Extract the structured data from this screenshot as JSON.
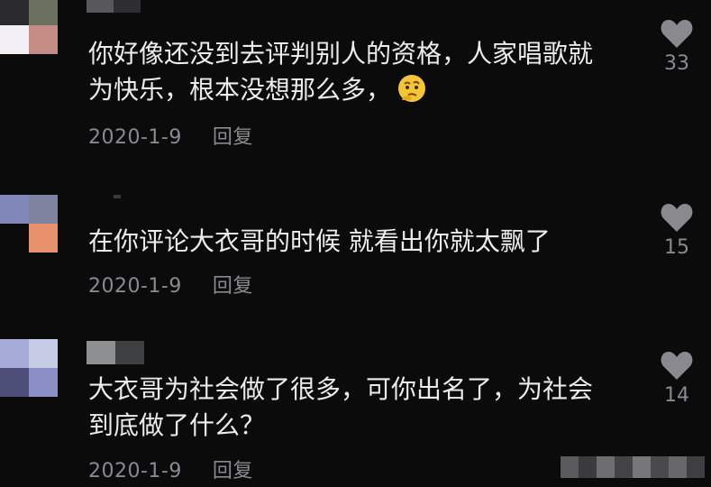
{
  "colors": {
    "background": "#0b0b0c",
    "text": "#ececec",
    "meta": "#8a8a8e",
    "heart": "#8a8a8e"
  },
  "comments": [
    {
      "text": "你好像还没到去评判别人的资格，人家唱歌就为快乐，根本没想那么多，",
      "line1": "你好像还没到去评判别人的资格，人家唱歌就",
      "line2": "为快乐，根本没想那么多，",
      "emoji": "thinking-face-emoji",
      "date": "2020-1-9",
      "reply_label": "回复",
      "likes": "33"
    },
    {
      "text": "在你评论大衣哥的时候 就看出你就太飘了",
      "line1": "在你评论大衣哥的时候 就看出你就太飘了",
      "date": "2020-1-9",
      "reply_label": "回复",
      "likes": "15"
    },
    {
      "text": "大衣哥为社会做了很多，可你出名了，为社会到底做了什么？",
      "line1": "大衣哥为社会做了很多，可你出名了，为社会",
      "line2": "到底做了什么？",
      "date": "2020-1-9",
      "reply_label": "回复",
      "likes": "14"
    }
  ],
  "icons": {
    "like": "heart-icon",
    "avatar": "pixelated-avatar",
    "watermark": "pixelated-watermark"
  }
}
